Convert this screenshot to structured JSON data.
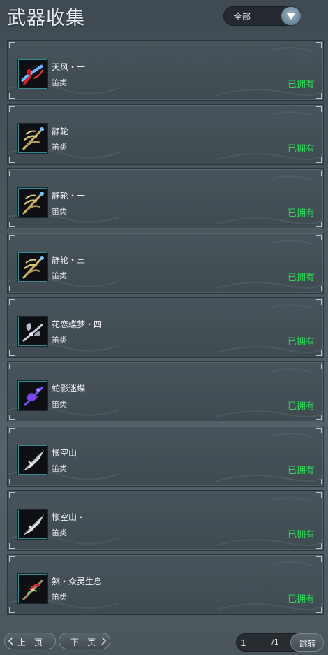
{
  "header": {
    "title": "武器收集",
    "filter_value": "全部"
  },
  "weapons": [
    {
      "name": "天风・一",
      "type": "笛类",
      "status": "已拥有",
      "icon": "red-flute-icon"
    },
    {
      "name": "静轮",
      "type": "笛类",
      "status": "已拥有",
      "icon": "golden-claw-flute-icon"
    },
    {
      "name": "静轮・一",
      "type": "笛类",
      "status": "已拥有",
      "icon": "golden-claw-flute-icon"
    },
    {
      "name": "静轮・三",
      "type": "笛类",
      "status": "已拥有",
      "icon": "golden-claw-flute-icon"
    },
    {
      "name": "花恋蝶梦・四",
      "type": "笛类",
      "status": "已拥有",
      "icon": "silver-butterfly-flute-icon"
    },
    {
      "name": "蛇影迷蝶",
      "type": "笛类",
      "status": "已拥有",
      "icon": "purple-serpent-flute-icon"
    },
    {
      "name": "怅空山",
      "type": "笛类",
      "status": "已拥有",
      "icon": "silver-blade-flute-icon"
    },
    {
      "name": "怅空山・一",
      "type": "笛类",
      "status": "已拥有",
      "icon": "silver-blade-flute-icon"
    },
    {
      "name": "煞・众灵生息",
      "type": "笛类",
      "status": "已拥有",
      "icon": "crimson-staff-flute-icon"
    }
  ],
  "pager": {
    "prev_label": "上一页",
    "next_label": "下一页",
    "current_page": "1",
    "total": "/1",
    "jump_label": "跳转"
  },
  "colors": {
    "owned": "#2fd65a",
    "accent": "#8fb0c4"
  }
}
